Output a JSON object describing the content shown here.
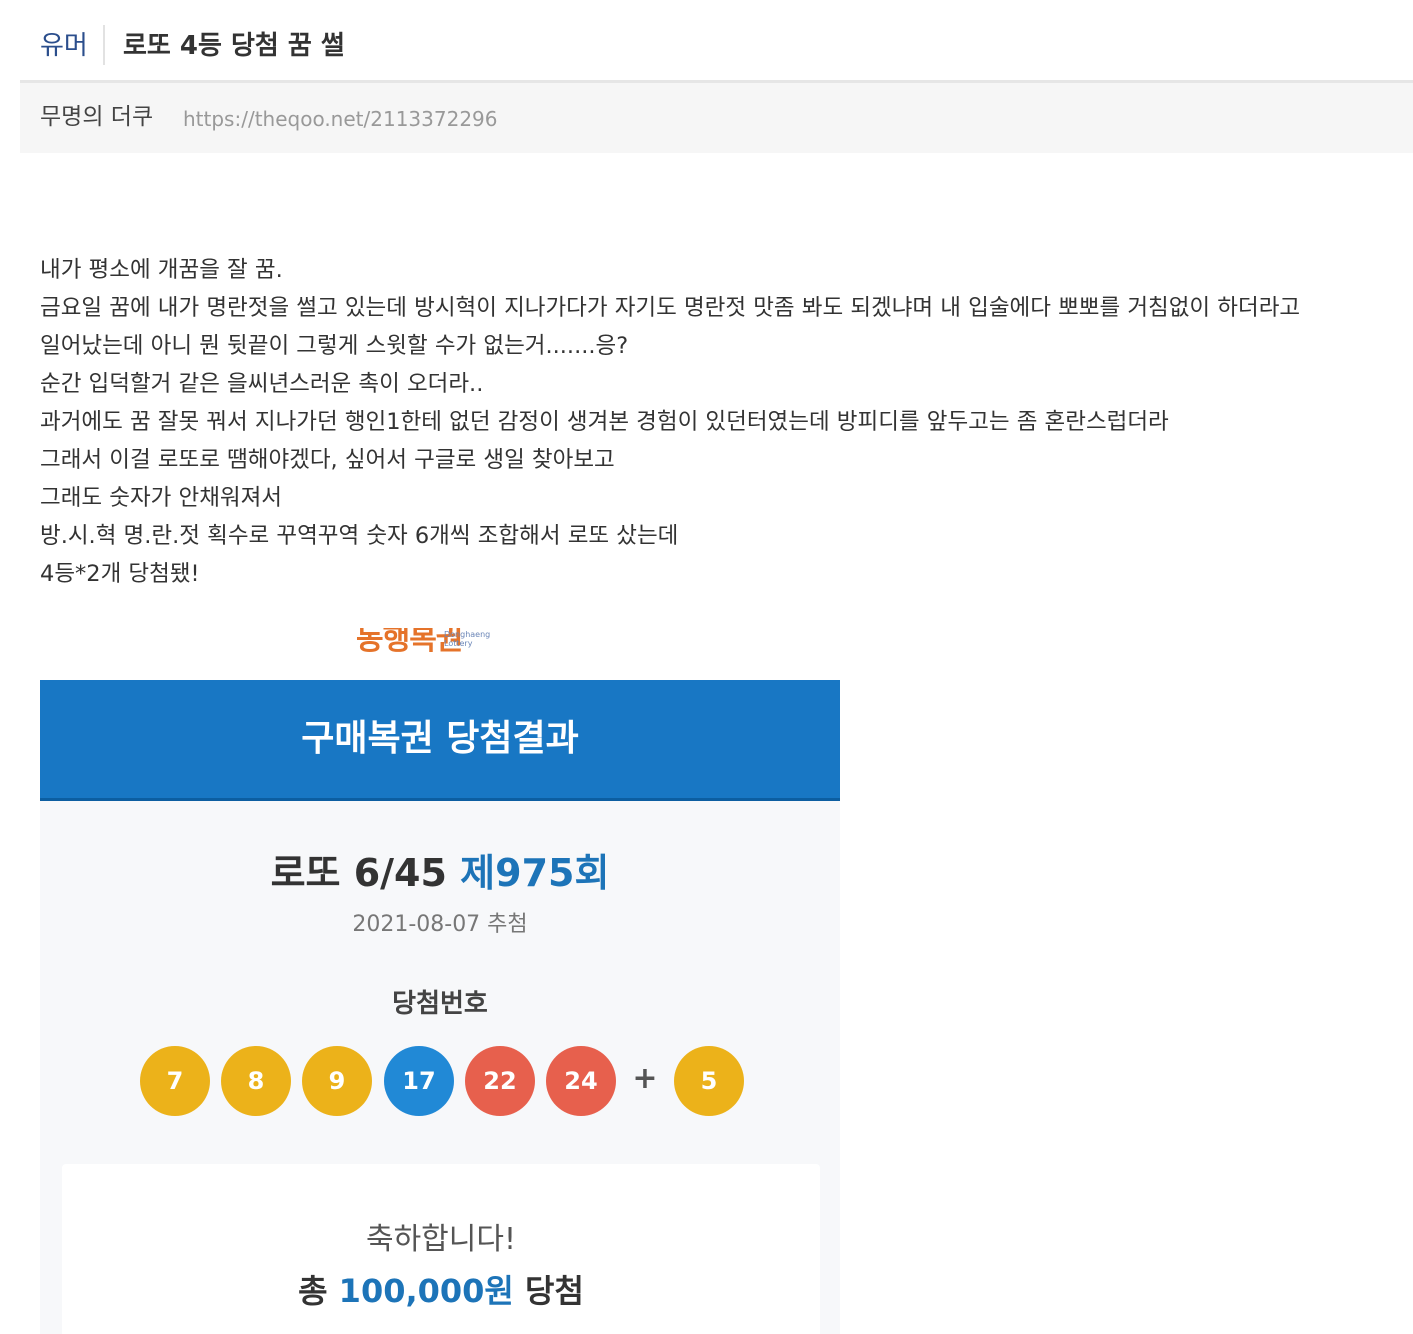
{
  "header": {
    "category": "유머",
    "title": "로또 4등 당첨 꿈 썰"
  },
  "meta": {
    "author": "무명의 더쿠",
    "url": "https://theqoo.net/2113372296"
  },
  "content": {
    "lines": [
      "내가 평소에 개꿈을 잘 꿈.",
      "금요일 꿈에 내가 명란젓을 썰고 있는데 방시혁이 지나가다가 자기도 명란젓 맛좀 봐도 되겠냐며 내 입술에다 뽀뽀를 거침없이 하더라고",
      "일어났는데 아니 뭔 뒷끝이 그렇게 스윗할 수가 없는거.......응?",
      "순간 입덕할거 같은 을씨년스러운 촉이 오더라..",
      "과거에도 꿈 잘못 꿔서 지나가던 행인1한테 없던 감정이 생겨본 경험이 있던터였는데 방피디를 앞두고는 좀 혼란스럽더라",
      "그래서 이걸 로또로 땜해야겠다, 싶어서 구글로 생일 찾아보고",
      "그래도 숫자가 안채워져서",
      "방.시.혁  명.란.젓  획수로 꾸역꾸역 숫자 6개씩 조합해서 로또 샀는데",
      "4등*2개 당첨됐!"
    ]
  },
  "lotto": {
    "logo_ko": "동행복권",
    "logo_en": "Donghaeng Lottery",
    "banner": "구매복권 당첨결과",
    "draw_title": "로또 6/45",
    "draw_no": "제975회",
    "draw_date": "2021-08-07 추첨",
    "winning_label": "당첨번호",
    "numbers": [
      "7",
      "8",
      "9",
      "17",
      "22",
      "24"
    ],
    "plus": "+",
    "bonus": "5",
    "congrats": "축하합니다!",
    "total_prefix": "총",
    "total_amount": "100,000원",
    "total_suffix": "당첨",
    "colors": {
      "yellow": "#ecb21a",
      "blue": "#2189d6",
      "red": "#e7604d",
      "banner": "#1877c4"
    }
  }
}
